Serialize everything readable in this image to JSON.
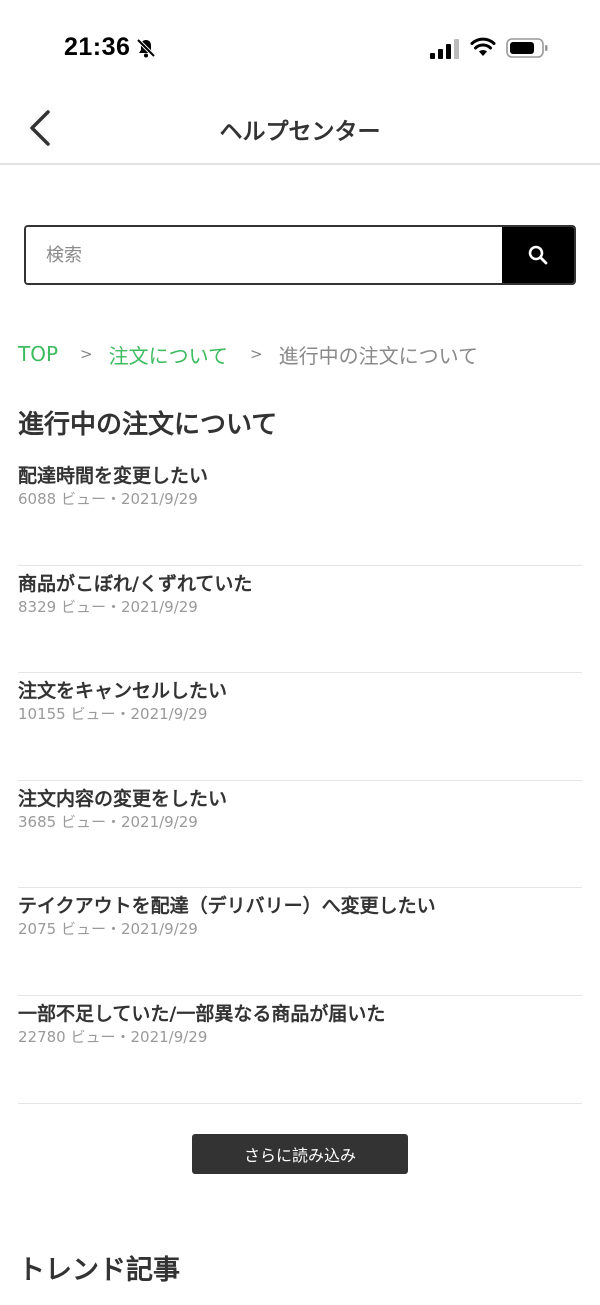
{
  "status_bar": {
    "time": "21:36",
    "icons": [
      "bell-slash-icon",
      "signal-icon",
      "wifi-icon",
      "battery-icon"
    ]
  },
  "header": {
    "title": "ヘルプセンター",
    "back_icon": "chevron-left-icon"
  },
  "search": {
    "placeholder": "検索",
    "value": "",
    "button_icon": "search-icon"
  },
  "breadcrumb": {
    "items": [
      "TOP",
      "注文について",
      "進行中の注文について"
    ],
    "separator": ">"
  },
  "section": {
    "title": "進行中の注文について"
  },
  "articles": [
    {
      "title": "配達時間を変更したい",
      "meta": "6088 ビュー・2021/9/29"
    },
    {
      "title": "商品がこぼれ/くずれていた",
      "meta": "8329 ビュー・2021/9/29"
    },
    {
      "title": "注文をキャンセルしたい",
      "meta": "10155 ビュー・2021/9/29"
    },
    {
      "title": "注文内容の変更をしたい",
      "meta": "3685 ビュー・2021/9/29"
    },
    {
      "title": "テイクアウトを配達（デリバリー）へ変更したい",
      "meta": "2075 ビュー・2021/9/29"
    },
    {
      "title": "一部不足していた/一部異なる商品が届いた",
      "meta": "22780 ビュー・2021/9/29"
    }
  ],
  "load_more_label": "さらに読み込み",
  "trend": {
    "title": "トレンド記事"
  },
  "colors": {
    "accent_green": "#3dbb5f",
    "dark": "#333333",
    "black": "#000000",
    "muted": "#9a9a9a"
  }
}
